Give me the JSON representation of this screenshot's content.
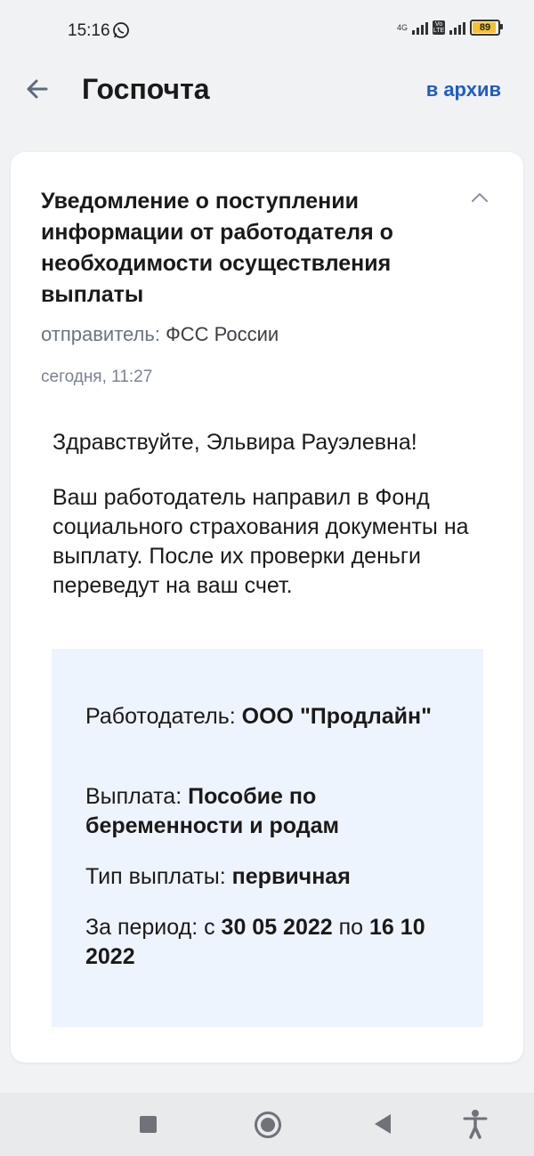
{
  "status_bar": {
    "time": "15:16",
    "network_label": "4G",
    "volte_label_top": "Vo",
    "volte_label_bottom": "LTE",
    "battery_level": "89",
    "icons": [
      "whatsapp-icon",
      "signal-icon",
      "volte-icon",
      "battery-icon"
    ]
  },
  "header": {
    "title": "Госпочта",
    "archive_label": "в архив",
    "accent_color": "#1e5cc8"
  },
  "message": {
    "title": "Уведомление о поступлении информации от работодателя о необходимости осуществления выплаты",
    "sender_label": "отправитель:",
    "sender_name": "ФСС России",
    "date": "сегодня, 11:27",
    "greeting": "Здравствуйте, Эльвира Рауэлевна!",
    "body": "Ваш работодатель направил в Фонд социального страхования документы на выплату. После их проверки деньги переведут на ваш счет.",
    "details": {
      "employer_label": "Работодатель:",
      "employer_value": "ООО \"Продлайн\"",
      "payment_label": "Выплата:",
      "payment_value": "Пособие по беременности и родам",
      "payment_type_label": "Тип выплаты:",
      "payment_type_value": "первичная",
      "period_label": "За период: с",
      "period_from": "30 05 2022",
      "period_to_label": "по",
      "period_to": "16 10 2022"
    }
  },
  "nav_bar": {
    "icons": [
      "recent-apps-icon",
      "home-icon",
      "back-icon",
      "accessibility-icon"
    ]
  }
}
